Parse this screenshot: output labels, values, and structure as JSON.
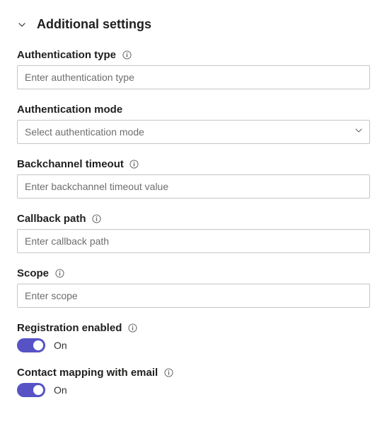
{
  "section": {
    "title": "Additional settings"
  },
  "fields": {
    "auth_type": {
      "label": "Authentication type",
      "placeholder": "Enter authentication type",
      "value": ""
    },
    "auth_mode": {
      "label": "Authentication mode",
      "placeholder": "Select authentication mode",
      "value": ""
    },
    "backchannel_timeout": {
      "label": "Backchannel timeout",
      "placeholder": "Enter backchannel timeout value",
      "value": ""
    },
    "callback_path": {
      "label": "Callback path",
      "placeholder": "Enter callback path",
      "value": ""
    },
    "scope": {
      "label": "Scope",
      "placeholder": "Enter scope",
      "value": ""
    },
    "registration_enabled": {
      "label": "Registration enabled",
      "value": true,
      "state_label": "On"
    },
    "contact_mapping": {
      "label": "Contact mapping with email",
      "value": true,
      "state_label": "On"
    }
  }
}
